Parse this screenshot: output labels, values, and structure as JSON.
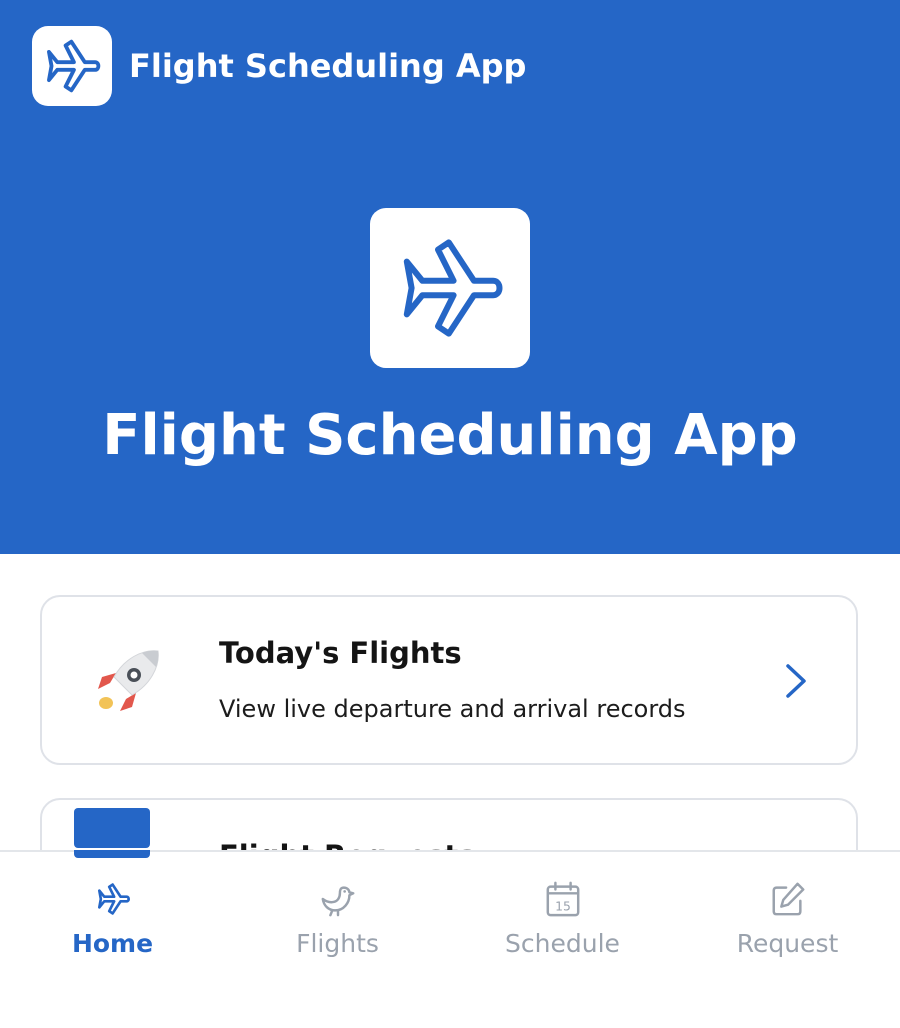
{
  "header": {
    "app_title": "Flight Scheduling App",
    "logo_icon": "airplane-icon"
  },
  "hero": {
    "title": "Flight Scheduling App",
    "logo_icon": "airplane-icon"
  },
  "cards": [
    {
      "title": "Today's Flights",
      "description": "View live departure and arrival records",
      "icon": "rocket-icon"
    },
    {
      "title": "Flight Requests",
      "icon": "calendar-icon"
    }
  ],
  "bottom_nav": {
    "active_index": 0,
    "items": [
      {
        "label": "Home",
        "icon": "airplane-icon"
      },
      {
        "label": "Flights",
        "icon": "bird-icon"
      },
      {
        "label": "Schedule",
        "icon": "calendar-15-icon",
        "icon_text": "15"
      },
      {
        "label": "Request",
        "icon": "edit-icon"
      }
    ]
  },
  "colors": {
    "brand_blue": "#2566c6",
    "inactive_gray": "#9aa2ad",
    "card_border": "#dfe2e8"
  }
}
